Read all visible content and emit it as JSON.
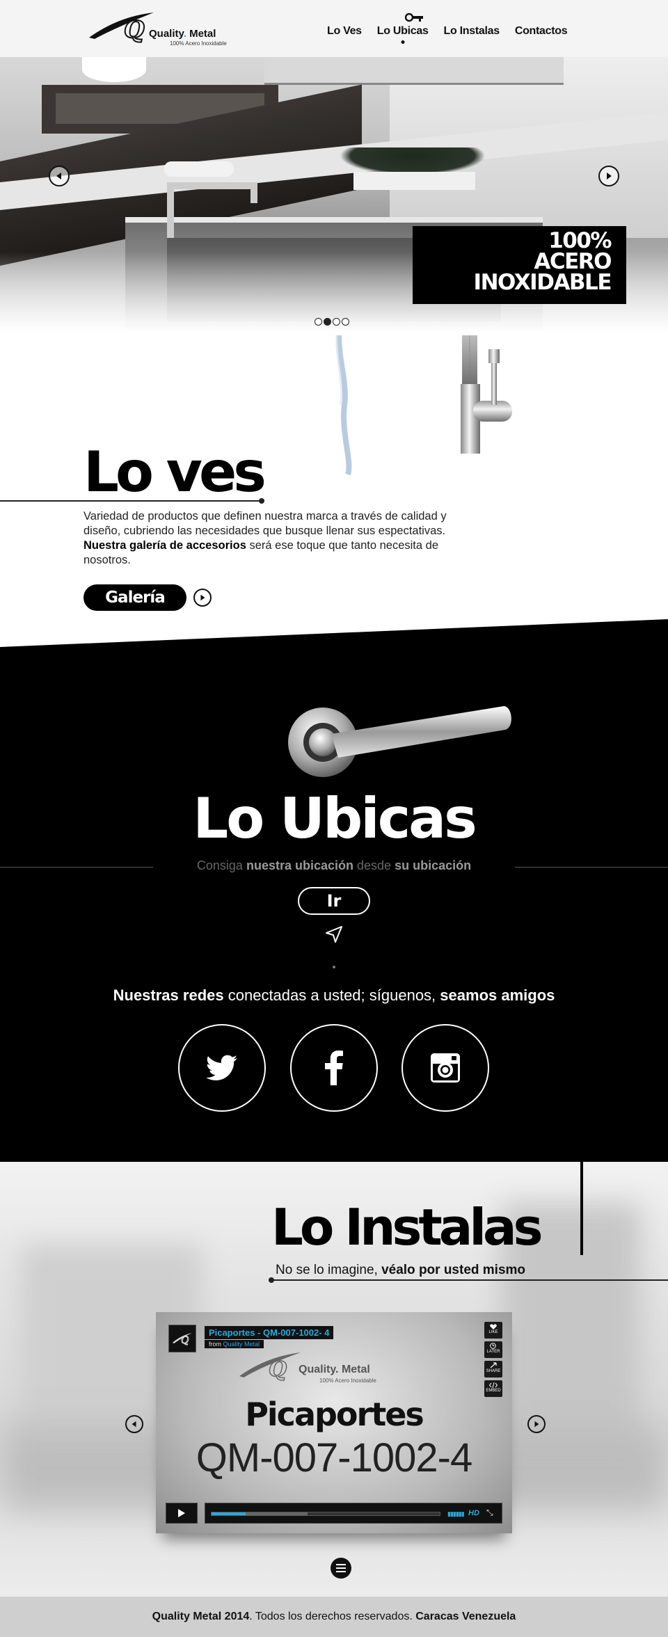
{
  "brand": {
    "name": "Quality",
    "name_dot": ".",
    "name2": "Metal",
    "tagline": "100% Acero Inoxidable"
  },
  "nav": {
    "items": [
      "Lo Ves",
      "Lo Ubicas",
      "Lo Instalas",
      "Contactos"
    ],
    "active": "Lo Ubicas"
  },
  "hero": {
    "badge_lines": [
      "100%",
      "ACERO",
      "INOXIDABLE"
    ],
    "slide_count": 4,
    "active_slide": 2
  },
  "loves": {
    "title": "Lo ves",
    "text_1": "Variedad de productos que definen nuestra marca a través de calidad y diseño, cubriendo las necesidades que busque llenar sus espectativas.",
    "text_bold": "Nuestra galería de accesorios",
    "text_2": "será ese toque que tanto necesita de nosotros.",
    "button": "Galería"
  },
  "ubicas": {
    "title": "Lo Ubicas",
    "sub_1": "Consiga",
    "sub_b1": "nuestra ubicación",
    "sub_2": "desde",
    "sub_b2": "su ubicación",
    "button": "Ir",
    "social_b1": "Nuestras redes",
    "social_1": "conectadas a usted; síguenos,",
    "social_b2": "seamos amigos"
  },
  "instalas": {
    "title": "Lo Instalas",
    "sub_1": "No se lo imagine,",
    "sub_b": "véalo por usted mismo"
  },
  "video": {
    "title": "Picaportes -  QM-007-1002- 4",
    "from_label": "from",
    "from_value": "Quality Metal",
    "side_buttons": [
      "LIKE",
      "LATER",
      "SHARE",
      "EMBED"
    ],
    "heading": "Picaportes",
    "code": "QM-007-1002-4",
    "hd": "HD",
    "progress": 0.15,
    "buffered": 0.42
  },
  "footer": {
    "b1": "Quality Metal 2014",
    "t1": ". Todos los derechos reservados.",
    "b2": "Caracas Venezuela"
  },
  "colors": {
    "accent": "#2aa8e0",
    "dark": "#000000",
    "light": "#f4f4f4"
  }
}
